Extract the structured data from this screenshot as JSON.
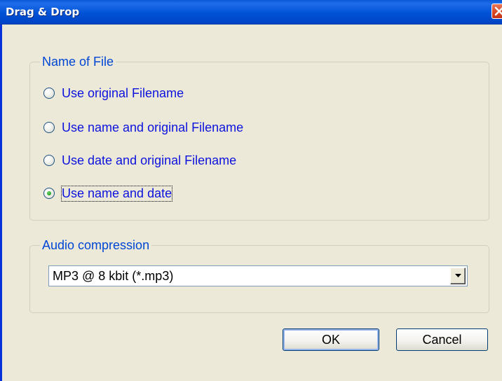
{
  "window": {
    "title": "Drag & Drop"
  },
  "name_group": {
    "legend": "Name of File",
    "options": [
      {
        "label": "Use original Filename",
        "checked": false
      },
      {
        "label": "Use name and original Filename",
        "checked": false
      },
      {
        "label": "Use date and original Filename",
        "checked": false
      },
      {
        "label": "Use name and date",
        "checked": true
      }
    ]
  },
  "audio_group": {
    "legend": "Audio compression",
    "selected": "MP3 @  8 kbit (*.mp3)"
  },
  "buttons": {
    "ok": "OK",
    "cancel": "Cancel"
  },
  "colors": {
    "titlebar": "#0054e3",
    "dialog_bg": "#ece9d8",
    "legend_text": "#0046d5",
    "option_text": "#0d13dd",
    "close_button": "#d9451f"
  },
  "icons": {
    "close": "close-icon",
    "dropdown": "chevron-down-icon"
  }
}
